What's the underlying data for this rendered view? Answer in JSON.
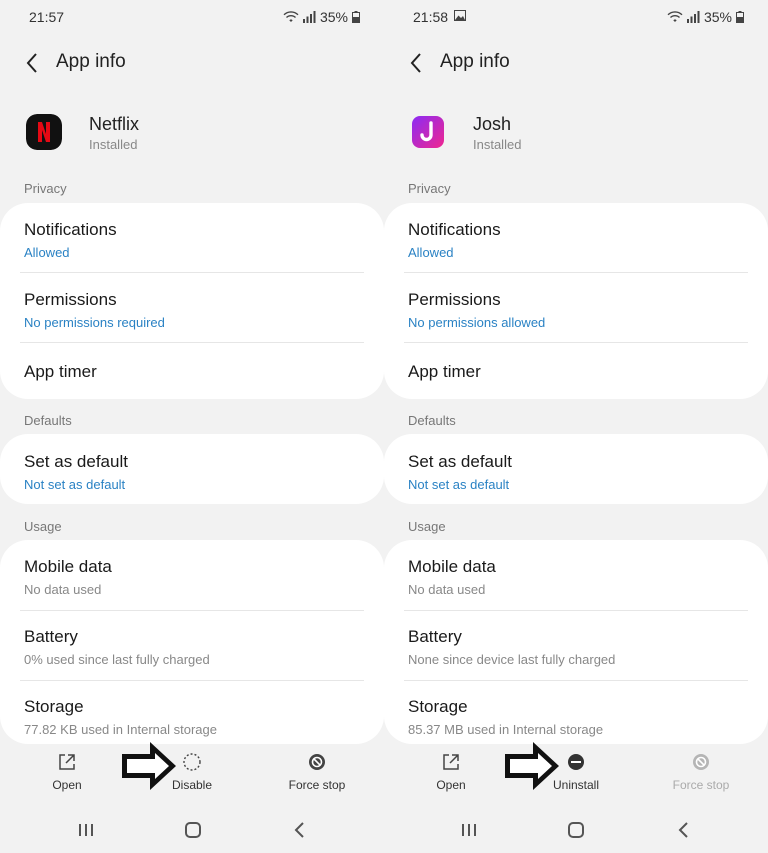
{
  "screens": [
    {
      "status": {
        "time": "21:57",
        "battery": "35%"
      },
      "header": {
        "title": "App info"
      },
      "app": {
        "name": "Netflix",
        "status": "Installed",
        "icon": "netflix-logo",
        "icon_color": "#e50914"
      },
      "privacy": {
        "label": "Privacy",
        "notifications": {
          "title": "Notifications",
          "value": "Allowed"
        },
        "permissions": {
          "title": "Permissions",
          "value": "No permissions required"
        },
        "app_timer": {
          "title": "App timer"
        }
      },
      "defaults": {
        "label": "Defaults",
        "set_default": {
          "title": "Set as default",
          "value": "Not set as default"
        }
      },
      "usage": {
        "label": "Usage",
        "mobile_data": {
          "title": "Mobile data",
          "value": "No data used"
        },
        "battery": {
          "title": "Battery",
          "value": "0% used since last fully charged"
        },
        "storage": {
          "title": "Storage",
          "value": "77.82 KB used in Internal storage"
        }
      },
      "actions": {
        "open": "Open",
        "middle": "Disable",
        "force_stop": "Force stop"
      }
    },
    {
      "status": {
        "time": "21:58",
        "battery": "35%"
      },
      "header": {
        "title": "App info"
      },
      "app": {
        "name": "Josh",
        "status": "Installed",
        "icon": "josh-logo",
        "icon_color": "#e0269b"
      },
      "privacy": {
        "label": "Privacy",
        "notifications": {
          "title": "Notifications",
          "value": "Allowed"
        },
        "permissions": {
          "title": "Permissions",
          "value": "No permissions allowed"
        },
        "app_timer": {
          "title": "App timer"
        }
      },
      "defaults": {
        "label": "Defaults",
        "set_default": {
          "title": "Set as default",
          "value": "Not set as default"
        }
      },
      "usage": {
        "label": "Usage",
        "mobile_data": {
          "title": "Mobile data",
          "value": "No data used"
        },
        "battery": {
          "title": "Battery",
          "value": "None since device last fully charged"
        },
        "storage": {
          "title": "Storage",
          "value": "85.37 MB used in Internal storage"
        }
      },
      "actions": {
        "open": "Open",
        "middle": "Uninstall",
        "force_stop": "Force stop"
      }
    }
  ],
  "colors": {
    "link_blue": "#2a82c4",
    "background": "#f2f2f2",
    "card": "#ffffff"
  }
}
